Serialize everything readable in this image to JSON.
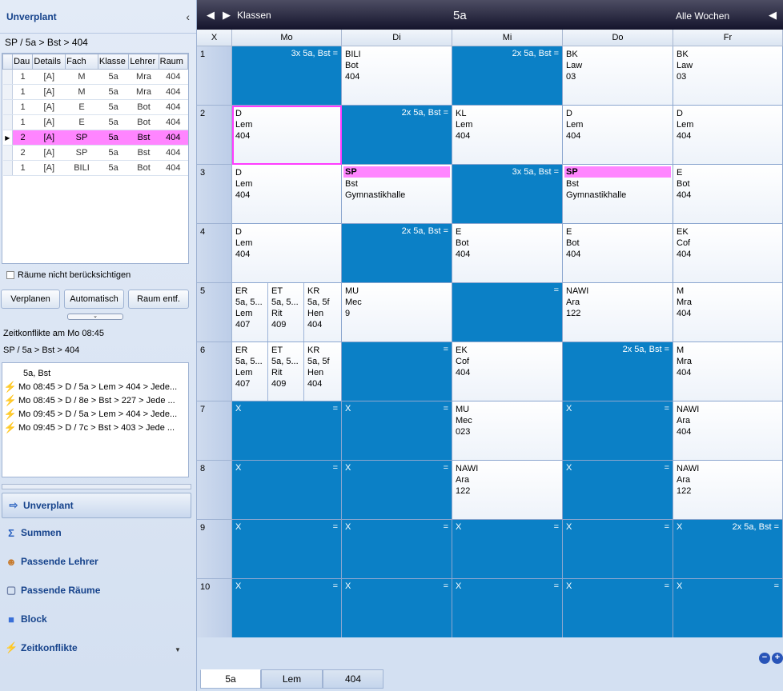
{
  "left_panel": {
    "title": "Unverplant",
    "collapse_icon": "chevron-left",
    "breadcrumb": "SP / 5a > Bst > 404",
    "grid": {
      "columns": [
        "Dau",
        "Details",
        "Fach",
        "Klasse",
        "Lehrer",
        "Raum"
      ],
      "rows": [
        [
          "1",
          "[A]",
          "M",
          "5a",
          "Mra",
          "404"
        ],
        [
          "1",
          "[A]",
          "M",
          "5a",
          "Mra",
          "404"
        ],
        [
          "1",
          "[A]",
          "E",
          "5a",
          "Bot",
          "404"
        ],
        [
          "1",
          "[A]",
          "E",
          "5a",
          "Bot",
          "404"
        ],
        [
          "2",
          "[A]",
          "SP",
          "5a",
          "Bst",
          "404"
        ],
        [
          "2",
          "[A]",
          "SP",
          "5a",
          "Bst",
          "404"
        ],
        [
          "1",
          "[A]",
          "BILI",
          "5a",
          "Bot",
          "404"
        ]
      ],
      "selected_row": 4,
      "selected_marker": "▶"
    },
    "checkbox_label": "Räume nicht berücksichtigen",
    "buttons": {
      "verplanen": "Verplanen",
      "automatisch": "Automatisch",
      "raum": "Raum entf."
    },
    "expander_icon": "double-chevron-down",
    "conflicts_title": "Zeitkonflikte am Mo 08:45",
    "conflicts_breadcrumb": "SP / 5a > Bst > 404",
    "conflicts": [
      {
        "text": "5a, Bst",
        "icon": ""
      },
      {
        "text": "Mo 08:45 > D / 5a > Lem > 404 > Jede...",
        "icon": "lightning"
      },
      {
        "text": "Mo 08:45 > D / 8e > Bst > 227 > Jede ...",
        "icon": "lightning"
      },
      {
        "text": "Mo 09:45 > D / 5a > Lem > 404 > Jede...",
        "icon": "lightning"
      },
      {
        "text": "Mo 09:45 > D / 7c > Bst > 403 > Jede ...",
        "icon": "lightning"
      }
    ],
    "nav": [
      {
        "label": "Unverplant",
        "icon": "unplanned-icon",
        "active": true
      },
      {
        "label": "Summen",
        "icon": "sigma-icon",
        "active": false
      },
      {
        "label": "Passende Lehrer",
        "icon": "teachers-icon",
        "active": false
      },
      {
        "label": "Passende Räume",
        "icon": "room-cube-icon",
        "active": false
      },
      {
        "label": "Block",
        "icon": "block-icon",
        "active": false
      },
      {
        "label": "Zeitkonflikte",
        "icon": "lightning-icon",
        "active": false
      }
    ],
    "nav_more_icon": "triangle-down"
  },
  "timetable": {
    "nav_label": "Klassen",
    "title": "5a",
    "weeks_label": "Alle Wochen",
    "corner": "X",
    "days": [
      "Mo",
      "Di",
      "Mi",
      "Do",
      "Fr"
    ],
    "periods": [
      "1",
      "2",
      "3",
      "4",
      "5",
      "6",
      "7",
      "8",
      "9",
      "10"
    ],
    "cells": [
      [
        {
          "t": "blue",
          "note": "3x 5a, Bst ="
        },
        {
          "t": "white",
          "lines": [
            "BILI",
            "Bot",
            "404"
          ]
        },
        {
          "t": "blue",
          "note": "2x 5a, Bst ="
        },
        {
          "t": "white",
          "lines": [
            "BK",
            "Law",
            "03"
          ]
        },
        {
          "t": "white",
          "lines": [
            "BK",
            "Law",
            "03"
          ]
        }
      ],
      [
        {
          "t": "white",
          "lines": [
            "D",
            "Lem",
            "404"
          ],
          "selected": true
        },
        {
          "t": "blue",
          "note": "2x 5a, Bst ="
        },
        {
          "t": "white",
          "lines": [
            "KL",
            "Lem",
            "404"
          ]
        },
        {
          "t": "white",
          "lines": [
            "D",
            "Lem",
            "404"
          ]
        },
        {
          "t": "white",
          "lines": [
            "D",
            "Lem",
            "404"
          ]
        }
      ],
      [
        {
          "t": "white",
          "lines": [
            "D",
            "Lem",
            "404"
          ]
        },
        {
          "t": "sp",
          "head": "SP",
          "lines": [
            "Bst",
            "Gymnastikhalle"
          ]
        },
        {
          "t": "blue",
          "note": "3x 5a, Bst ="
        },
        {
          "t": "sp",
          "head": "SP",
          "lines": [
            "Bst",
            "Gymnastikhalle"
          ]
        },
        {
          "t": "white",
          "lines": [
            "E",
            "Bot",
            "404"
          ]
        }
      ],
      [
        {
          "t": "white",
          "lines": [
            "D",
            "Lem",
            "404"
          ]
        },
        {
          "t": "blue",
          "note": "2x 5a, Bst ="
        },
        {
          "t": "white",
          "lines": [
            "E",
            "Bot",
            "404"
          ]
        },
        {
          "t": "white",
          "lines": [
            "E",
            "Bot",
            "404"
          ]
        },
        {
          "t": "white",
          "lines": [
            "EK",
            "Cof",
            "404"
          ]
        }
      ],
      [
        {
          "t": "split",
          "subs": [
            [
              "ER",
              "5a, 5...",
              "Lem",
              "407"
            ],
            [
              "ET",
              "5a, 5...",
              "Rit",
              "409"
            ],
            [
              "KR",
              "5a, 5f",
              "Hen",
              "404"
            ]
          ]
        },
        {
          "t": "white",
          "lines": [
            "MU",
            "Mec",
            "9"
          ]
        },
        {
          "t": "blue",
          "note": "="
        },
        {
          "t": "white",
          "lines": [
            "NAWI",
            "Ara",
            "122"
          ]
        },
        {
          "t": "white",
          "lines": [
            "M",
            "Mra",
            "404"
          ]
        }
      ],
      [
        {
          "t": "split",
          "subs": [
            [
              "ER",
              "5a, 5...",
              "Lem",
              "407"
            ],
            [
              "ET",
              "5a, 5...",
              "Rit",
              "409"
            ],
            [
              "KR",
              "5a, 5f",
              "Hen",
              "404"
            ]
          ]
        },
        {
          "t": "blue",
          "note": "="
        },
        {
          "t": "white",
          "lines": [
            "EK",
            "Cof",
            "404"
          ]
        },
        {
          "t": "blue",
          "note": "2x 5a, Bst ="
        },
        {
          "t": "white",
          "lines": [
            "M",
            "Mra",
            "404"
          ]
        }
      ],
      [
        {
          "t": "blue",
          "x": "X",
          "eq": "="
        },
        {
          "t": "blue",
          "x": "X",
          "eq": "="
        },
        {
          "t": "white",
          "lines": [
            "MU",
            "Mec",
            "023"
          ]
        },
        {
          "t": "blue",
          "x": "X",
          "eq": "="
        },
        {
          "t": "white",
          "lines": [
            "NAWI",
            "Ara",
            "404"
          ]
        }
      ],
      [
        {
          "t": "blue",
          "x": "X",
          "eq": "="
        },
        {
          "t": "blue",
          "x": "X",
          "eq": "="
        },
        {
          "t": "white",
          "lines": [
            "NAWI",
            "Ara",
            "122"
          ]
        },
        {
          "t": "blue",
          "x": "X",
          "eq": "="
        },
        {
          "t": "white",
          "lines": [
            "NAWI",
            "Ara",
            "122"
          ]
        }
      ],
      [
        {
          "t": "blue",
          "x": "X",
          "eq": "="
        },
        {
          "t": "blue",
          "x": "X",
          "eq": "="
        },
        {
          "t": "blue",
          "x": "X",
          "eq": "="
        },
        {
          "t": "blue",
          "x": "X",
          "eq": "="
        },
        {
          "t": "blue",
          "x": "X",
          "eq": "2x 5a, Bst ="
        }
      ],
      [
        {
          "t": "blue",
          "x": "X",
          "eq": "="
        },
        {
          "t": "blue",
          "x": "X",
          "eq": "="
        },
        {
          "t": "blue",
          "x": "X",
          "eq": "="
        },
        {
          "t": "blue",
          "x": "X",
          "eq": "="
        },
        {
          "t": "blue",
          "x": "X",
          "eq": "="
        }
      ]
    ],
    "zoom": {
      "out": "−",
      "in": "+"
    }
  },
  "tabs": [
    "5a",
    "Lem",
    "404"
  ],
  "active_tab": 0,
  "colors": {
    "blocked": "#0b80c6",
    "highlight": "#ff85ff",
    "selected_border": "#ff3cff"
  }
}
